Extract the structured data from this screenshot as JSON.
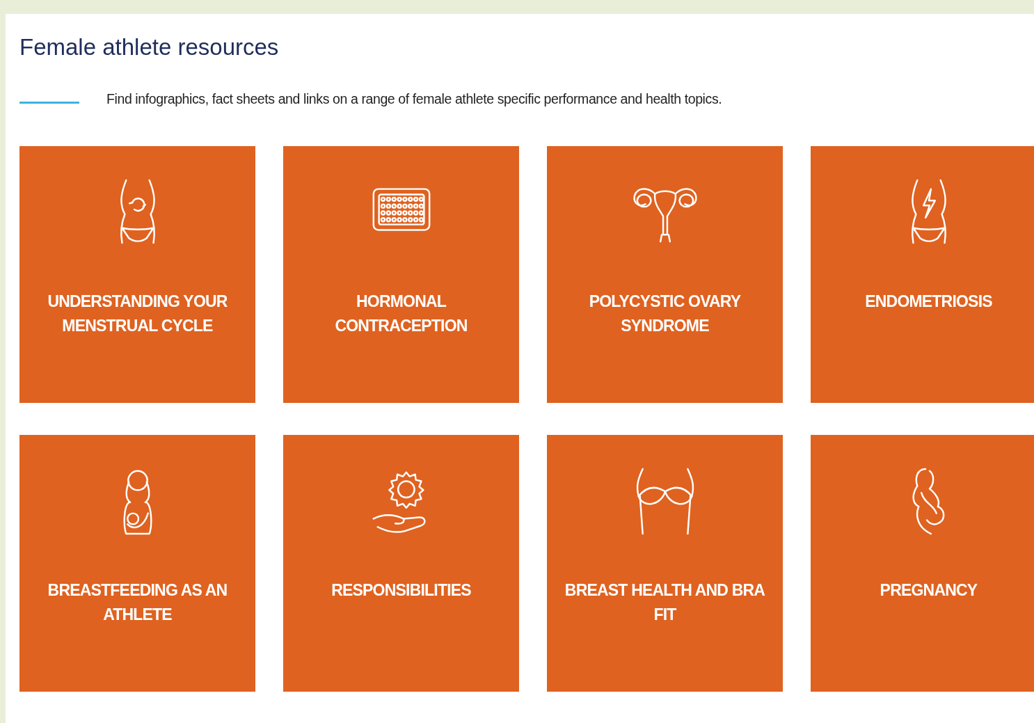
{
  "title": "Female athlete resources",
  "intro": "Find infographics, fact sheets and links on a range of female athlete specific performance and health topics.",
  "tiles": [
    {
      "label": "UNDERSTANDING YOUR MENSTRUAL CYCLE"
    },
    {
      "label": "HORMONAL CONTRACEPTION"
    },
    {
      "label": "POLYCYSTIC OVARY SYNDROME"
    },
    {
      "label": "ENDOMETRIOSIS"
    },
    {
      "label": "BREASTFEEDING AS AN ATHLETE"
    },
    {
      "label": "RESPONSIBILITIES"
    },
    {
      "label": "BREAST HEALTH AND BRA FIT"
    },
    {
      "label": "PREGNANCY"
    }
  ]
}
